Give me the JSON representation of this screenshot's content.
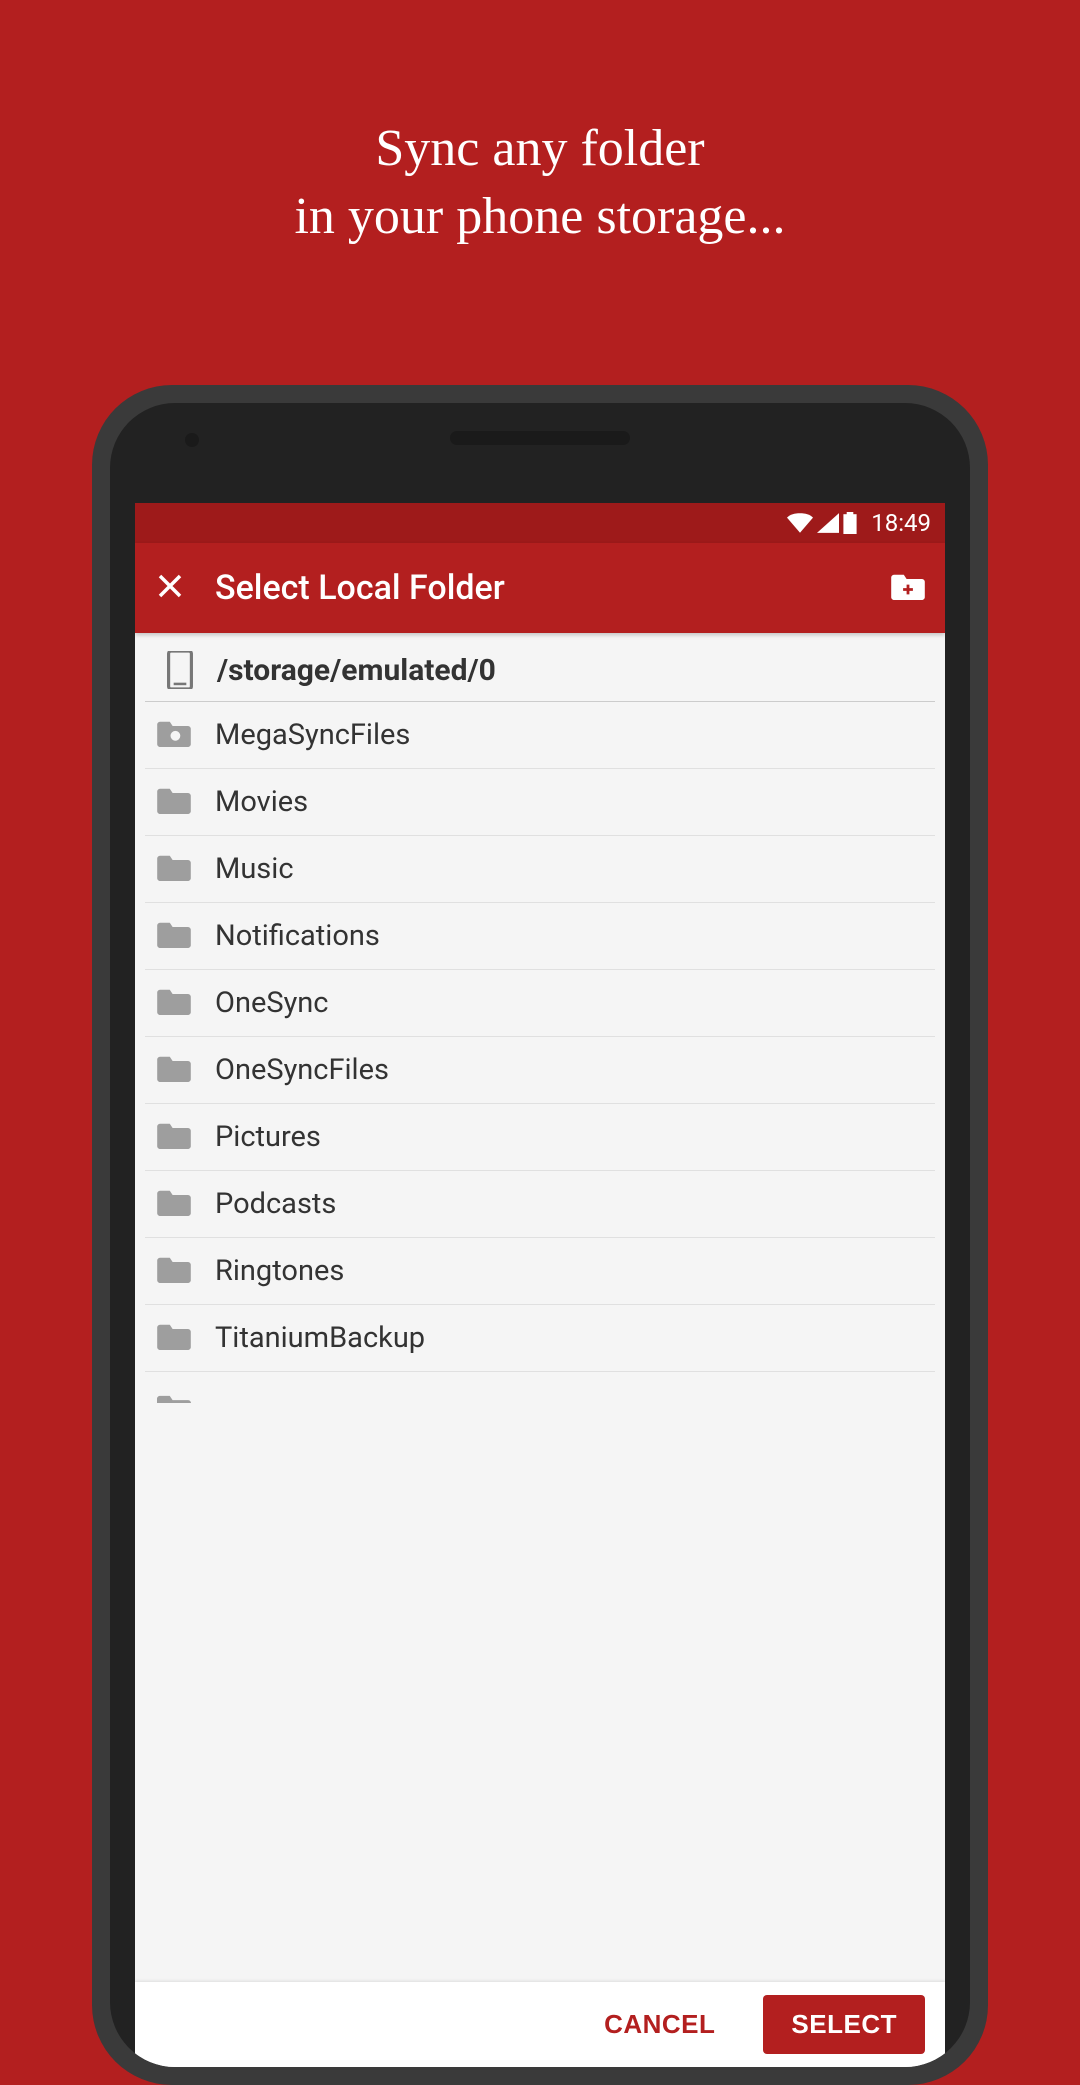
{
  "promo": {
    "line1": "Sync any folder",
    "line2": "in your phone storage..."
  },
  "status": {
    "time": "18:49"
  },
  "appbar": {
    "title": "Select Local Folder"
  },
  "path": "/storage/emulated/0",
  "folders": [
    {
      "name": "MegaSyncFiles",
      "special": true
    },
    {
      "name": "Movies"
    },
    {
      "name": "Music"
    },
    {
      "name": "Notifications"
    },
    {
      "name": "OneSync"
    },
    {
      "name": "OneSyncFiles"
    },
    {
      "name": "Pictures"
    },
    {
      "name": "Podcasts"
    },
    {
      "name": "Ringtones"
    },
    {
      "name": "TitaniumBackup"
    }
  ],
  "buttons": {
    "cancel": "CANCEL",
    "select": "SELECT"
  }
}
